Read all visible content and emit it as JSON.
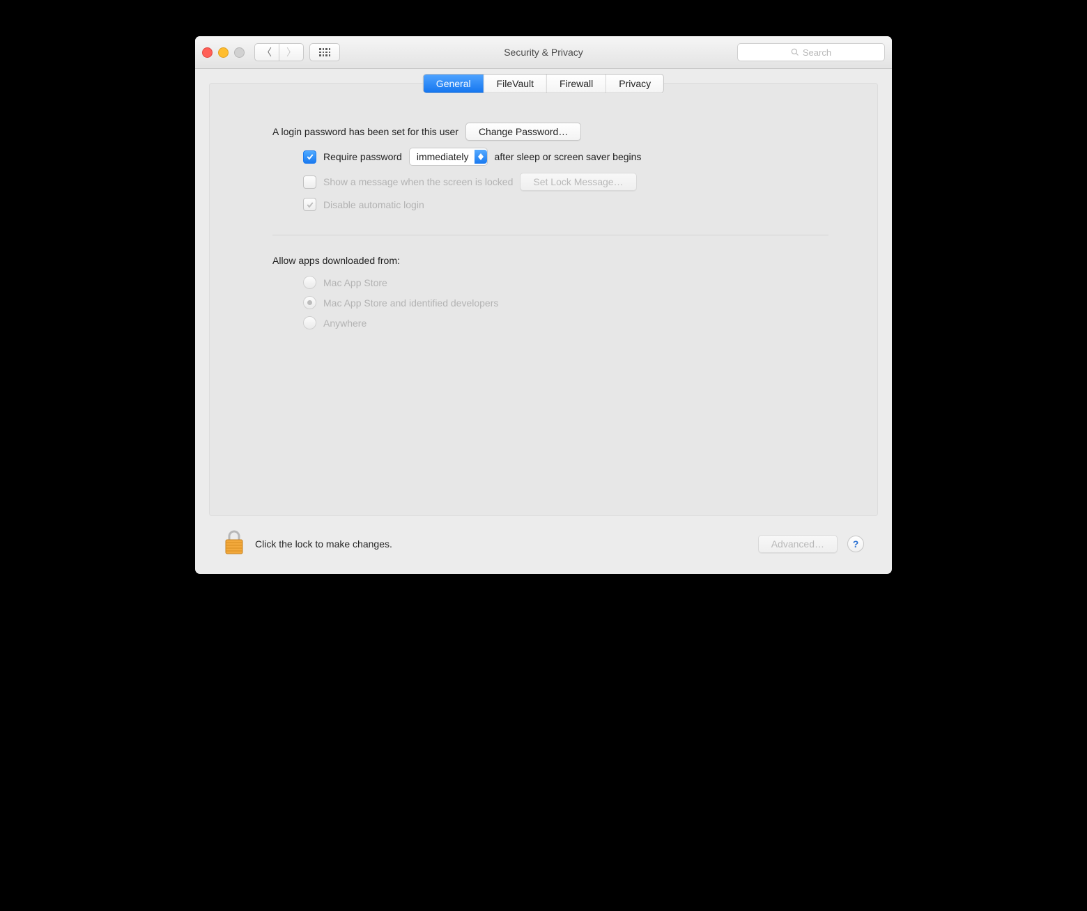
{
  "titlebar": {
    "title": "Security & Privacy",
    "search_placeholder": "Search"
  },
  "tabs": [
    "General",
    "FileVault",
    "Firewall",
    "Privacy"
  ],
  "selected_tab": 0,
  "general": {
    "password_set_msg": "A login password has been set for this user",
    "change_password_btn": "Change Password…",
    "require_password": {
      "checked": true,
      "prefix": "Require password",
      "delay_value": "immediately",
      "suffix": "after sleep or screen saver begins"
    },
    "show_message": {
      "checked": false,
      "enabled": false,
      "label": "Show a message when the screen is locked",
      "button": "Set Lock Message…"
    },
    "disable_auto_login": {
      "checked": true,
      "enabled": false,
      "label": "Disable automatic login"
    },
    "allow_apps": {
      "heading": "Allow apps downloaded from:",
      "enabled": false,
      "options": [
        "Mac App Store",
        "Mac App Store and identified developers",
        "Anywhere"
      ],
      "selected": 1
    }
  },
  "footer": {
    "lock_text": "Click the lock to make changes.",
    "advanced_btn": "Advanced…",
    "help": "?"
  }
}
